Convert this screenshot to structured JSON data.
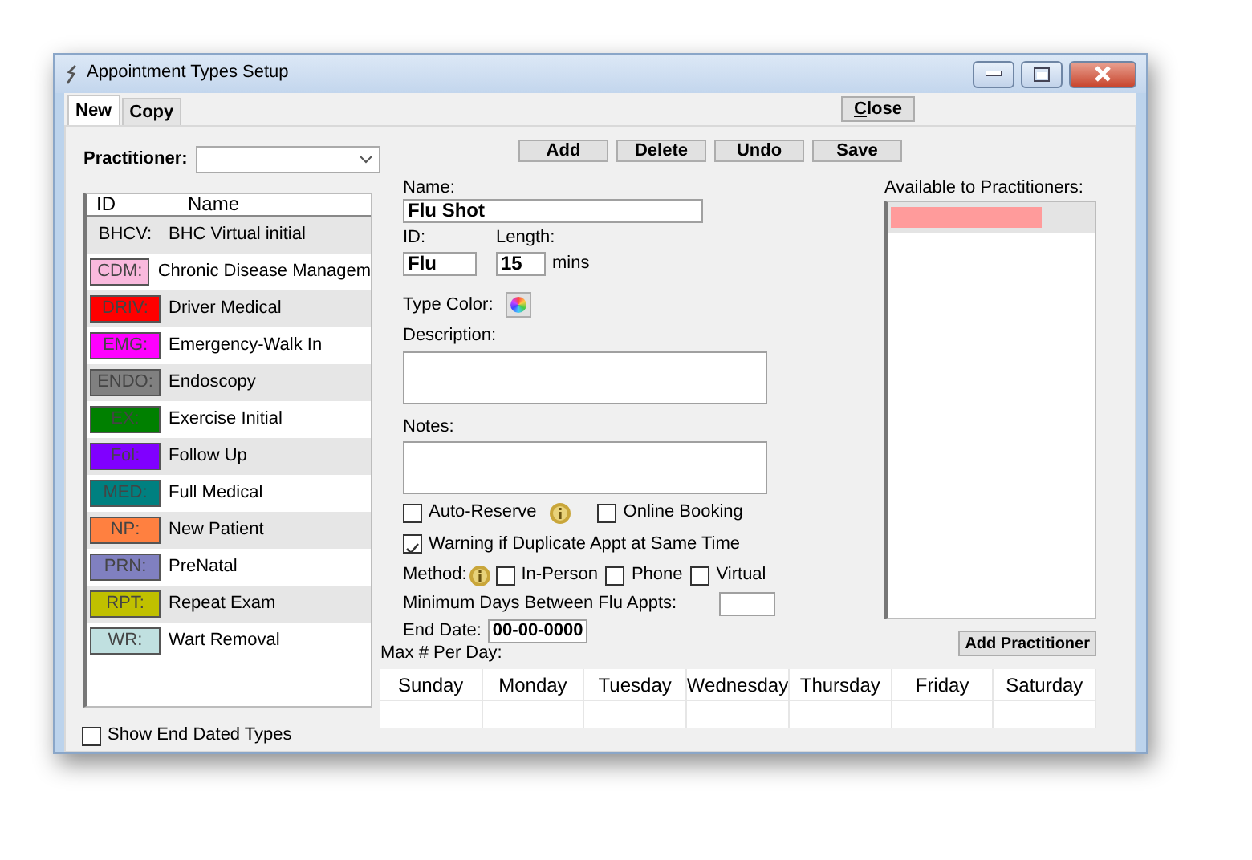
{
  "window": {
    "title": "Appointment Types Setup"
  },
  "tabs": [
    {
      "label": "New",
      "selected": true
    },
    {
      "label": "Copy",
      "selected": false
    }
  ],
  "close_button": "Close",
  "practitioner": {
    "label": "Practitioner:"
  },
  "types": {
    "columns": [
      "ID",
      "Name"
    ],
    "rows": [
      {
        "id": "BHCV:",
        "name": "BHC Virtual initial"
      },
      {
        "id": "CDM:",
        "name": "Chronic Disease Managem",
        "color": "#f9b9dd"
      },
      {
        "id": "DRIV:",
        "name": "Driver Medical",
        "color": "#ff0000"
      },
      {
        "id": "EMG:",
        "name": "Emergency-Walk In",
        "color": "#ff00ff"
      },
      {
        "id": "ENDO:",
        "name": "Endoscopy",
        "color": "#808080"
      },
      {
        "id": "EX:",
        "name": "Exercise Initial",
        "color": "#008000"
      },
      {
        "id": "Fol:",
        "name": "Follow Up",
        "color": "#8000ff"
      },
      {
        "id": "MED:",
        "name": "Full Medical",
        "color": "#008080"
      },
      {
        "id": "NP:",
        "name": "New Patient",
        "color": "#ff8040"
      },
      {
        "id": "PRN:",
        "name": "PreNatal",
        "color": "#8080c0"
      },
      {
        "id": "RPT:",
        "name": "Repeat Exam",
        "color": "#c0c000"
      },
      {
        "id": "WR:",
        "name": "Wart Removal",
        "color": "#c0e0e0"
      }
    ]
  },
  "show_end_dated": {
    "label": "Show End Dated Types",
    "checked": false
  },
  "toolbar": [
    "Add",
    "Delete",
    "Undo",
    "Save"
  ],
  "form": {
    "name": {
      "label": "Name:",
      "value": "Flu Shot"
    },
    "id": {
      "label": "ID:",
      "value": "Flu"
    },
    "length": {
      "label": "Length:",
      "value": "15",
      "unit": "mins"
    },
    "type_color": {
      "label": "Type Color:"
    },
    "description": {
      "label": "Description:"
    },
    "notes": {
      "label": "Notes:"
    },
    "auto_reserve": {
      "label": "Auto-Reserve",
      "checked": false
    },
    "online_booking": {
      "label": "Online Booking",
      "checked": false
    },
    "warning": {
      "label": "Warning if Duplicate Appt at Same Time",
      "checked": true
    },
    "method": {
      "label": "Method:",
      "options": [
        {
          "label": "In-Person",
          "checked": false
        },
        {
          "label": "Phone",
          "checked": false
        },
        {
          "label": "Virtual",
          "checked": false
        }
      ]
    },
    "min_days": {
      "label": "Minimum Days Between Flu Appts:"
    },
    "end_date": {
      "label": "End Date:",
      "value": "00-00-0000"
    }
  },
  "available": {
    "label": "Available to Practitioners:",
    "items": [
      {
        "selected": true
      }
    ]
  },
  "add_practitioner": "Add Practitioner",
  "max_per_day": {
    "label": "Max # Per Day:",
    "days": [
      "Sunday",
      "Monday",
      "Tuesday",
      "Wednesday",
      "Thursday",
      "Friday",
      "Saturday"
    ]
  }
}
